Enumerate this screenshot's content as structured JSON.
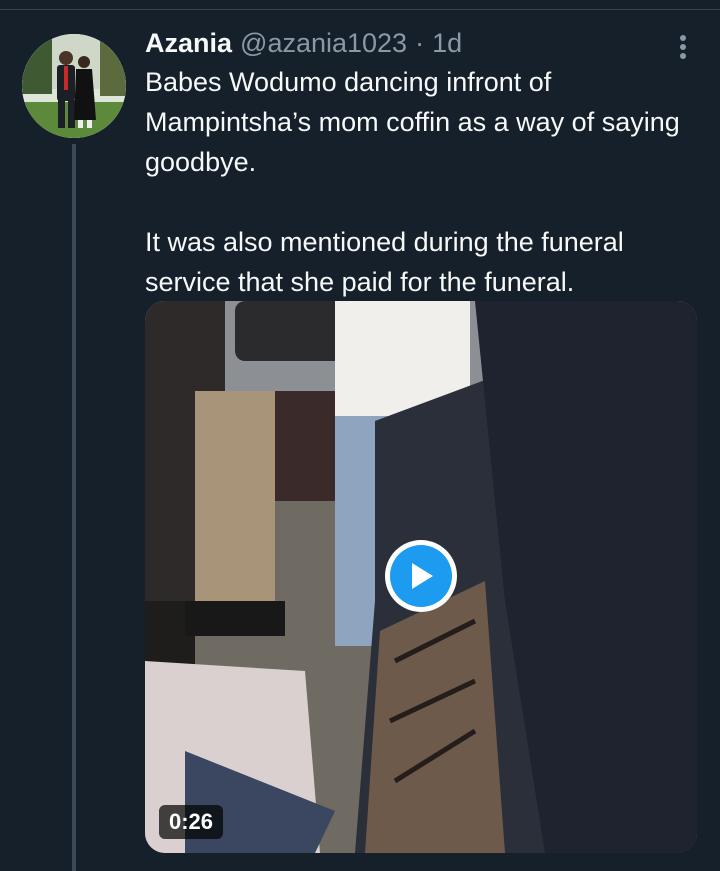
{
  "tweet": {
    "display_name": "Azania",
    "handle": "@azania1023",
    "separator": "·",
    "time": "1d",
    "text_paragraphs": [
      "Babes Wodumo dancing infront of Mampintsha’s mom coffin as a way of saying goodbye.",
      "It was also mentioned during the funeral service that she paid for the funeral."
    ],
    "media": {
      "type": "video",
      "duration": "0:26"
    }
  },
  "icons": {
    "more": "more-vertical-icon",
    "play": "play-icon"
  },
  "colors": {
    "background": "#15202b",
    "text_primary": "#f7f9f9",
    "text_secondary": "#8b98a5",
    "thread_line": "#3b4a57",
    "accent": "#1d9bf0"
  }
}
